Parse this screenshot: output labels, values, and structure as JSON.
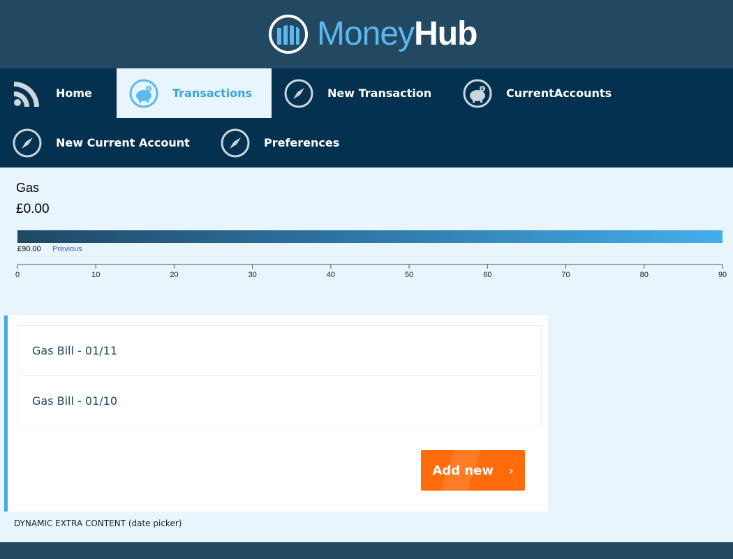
{
  "brand": {
    "name_part1": "Money",
    "name_part2": "Hub",
    "primary_color": "#224862",
    "accent_color": "#5ab8ee"
  },
  "nav": {
    "items": [
      {
        "label": "Home",
        "icon": "rss-icon",
        "active": false
      },
      {
        "label": "Transactions",
        "icon": "piggy-bank-icon",
        "active": true
      },
      {
        "label": "New Transaction",
        "icon": "compass-icon",
        "active": false
      },
      {
        "label": "CurrentAccounts",
        "icon": "piggy-bank-icon",
        "active": false
      },
      {
        "label": "New Current Account",
        "icon": "compass-icon",
        "active": false
      },
      {
        "label": "Preferences",
        "icon": "compass-icon",
        "active": false
      }
    ]
  },
  "summary": {
    "category": "Gas",
    "amount": "£0.00",
    "bar_label": "£90.00",
    "previous_link": "Previous",
    "bar_fill_fraction": 1.0,
    "axis_ticks": [
      "0",
      "10",
      "20",
      "30",
      "40",
      "50",
      "60",
      "70",
      "80",
      "90"
    ]
  },
  "transactions": {
    "items": [
      {
        "label": "Gas Bill - 01/11"
      },
      {
        "label": "Gas Bill - 01/10"
      }
    ],
    "add_button": "Add new",
    "add_chevron": "›",
    "button_color": "#ff6a0a"
  },
  "extra_content": "DYNAMIC EXTRA CONTENT (date picker)"
}
